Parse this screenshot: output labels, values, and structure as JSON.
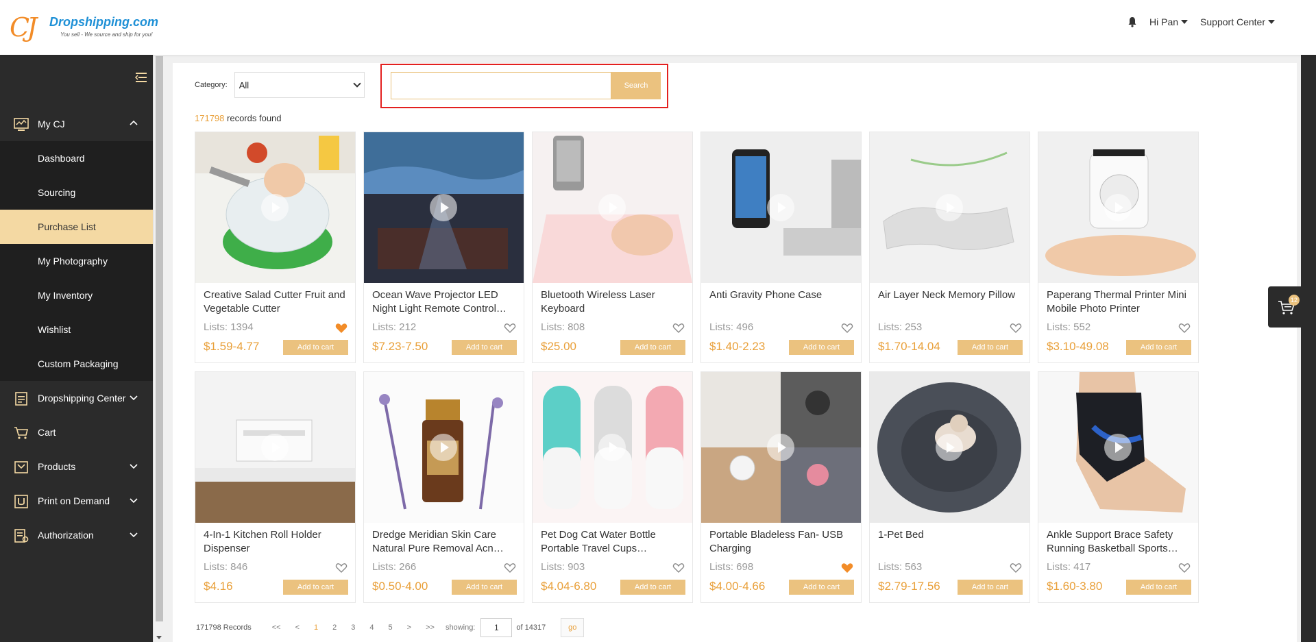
{
  "header": {
    "logo": {
      "mark": "CJ",
      "brand": "Dropshipping.com",
      "tagline": "You sell - We source and ship for you!"
    },
    "user_label": "Hi Pan",
    "support_label": "Support Center"
  },
  "sidebar": {
    "items": [
      {
        "label": "My CJ",
        "icon": "monitor-chart-icon",
        "expanded": true
      },
      {
        "label": "Dropshipping Center",
        "icon": "clipboard-list-icon"
      },
      {
        "label": "Cart",
        "icon": "cart-icon"
      },
      {
        "label": "Products",
        "icon": "tag-box-icon"
      },
      {
        "label": "Print on Demand",
        "icon": "print-u-icon"
      },
      {
        "label": "Authorization",
        "icon": "settings-doc-icon"
      }
    ],
    "sub_items": [
      "Dashboard",
      "Sourcing",
      "Purchase List",
      "My Photography",
      "My Inventory",
      "Wishlist",
      "Custom Packaging"
    ],
    "active_sub": "Purchase List"
  },
  "filter": {
    "category_label": "Category:",
    "category_value": "All",
    "search_placeholder": "",
    "search_button": "Search"
  },
  "records": {
    "count": "171798",
    "suffix": "records found"
  },
  "products": [
    {
      "title": "Creative Salad Cutter Fruit and Vegetable Cutter",
      "lists": "Lists: 1394",
      "price": "$1.59-4.77",
      "liked": true
    },
    {
      "title": "Ocean Wave Projector LED Night Light Remote Control…",
      "lists": "Lists: 212",
      "price": "$7.23-7.50",
      "liked": false
    },
    {
      "title": "Bluetooth Wireless Laser Keyboard",
      "lists": "Lists: 808",
      "price": "$25.00",
      "liked": false
    },
    {
      "title": "Anti Gravity Phone Case",
      "lists": "Lists: 496",
      "price": "$1.40-2.23",
      "liked": false
    },
    {
      "title": "Air Layer Neck Memory Pillow",
      "lists": "Lists: 253",
      "price": "$1.70-14.04",
      "liked": false
    },
    {
      "title": "Paperang Thermal Printer Mini Mobile Photo Printer",
      "lists": "Lists: 552",
      "price": "$3.10-49.08",
      "liked": false
    },
    {
      "title": "4-In-1 Kitchen Roll Holder Dispenser",
      "lists": "Lists: 846",
      "price": "$4.16",
      "liked": false
    },
    {
      "title": "Dredge Meridian Skin Care Natural Pure Removal Acn…",
      "lists": "Lists: 266",
      "price": "$0.50-4.00",
      "liked": false
    },
    {
      "title": "Pet Dog Cat Water Bottle Portable Travel Cups…",
      "lists": "Lists: 903",
      "price": "$4.04-6.80",
      "liked": false
    },
    {
      "title": "Portable Bladeless Fan- USB Charging",
      "lists": "Lists: 698",
      "price": "$4.00-4.66",
      "liked": true
    },
    {
      "title": "1-Pet Bed",
      "lists": "Lists: 563",
      "price": "$2.79-17.56",
      "liked": false
    },
    {
      "title": "Ankle Support Brace Safety Running Basketball Sports…",
      "lists": "Lists: 417",
      "price": "$1.60-3.80",
      "liked": false
    }
  ],
  "add_to_cart_label": "Add to cart",
  "pagination": {
    "records": "171798 Records",
    "first": "<<",
    "prev": "<",
    "pages": [
      "1",
      "2",
      "3",
      "4",
      "5"
    ],
    "current": "1",
    "next": ">",
    "last": ">>",
    "showing_label": "showing:",
    "page_value": "1",
    "of_label": "of 14317",
    "go_label": "go"
  },
  "floating_cart": {
    "count": "12"
  },
  "colors": {
    "accent": "#ebc27f",
    "price": "#e9a03a",
    "sidebar": "#2b2b2b",
    "highlight": "#e3201f",
    "liked": "#f28c28"
  }
}
